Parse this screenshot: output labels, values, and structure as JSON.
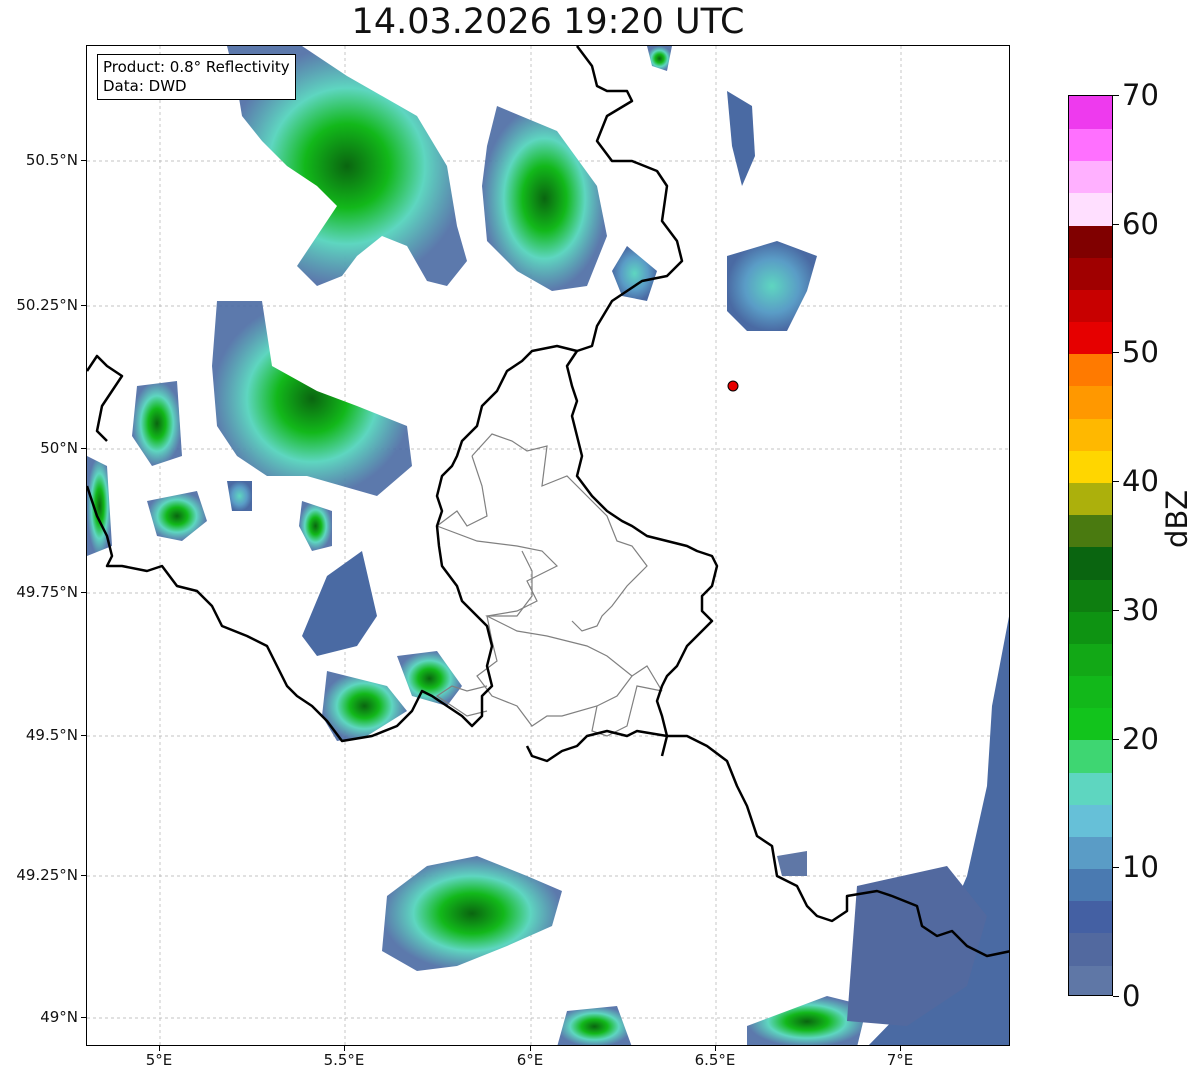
{
  "title": "14.03.2026 19:20 UTC",
  "info_box": {
    "product": "Product: 0.8° Reflectivity",
    "data": "Data: DWD"
  },
  "axes": {
    "lon_ticks": [
      "5°E",
      "5.5°E",
      "6°E",
      "6.5°E",
      "7°E"
    ],
    "lat_ticks": [
      "50.5°N",
      "50.25°N",
      "50°N",
      "49.75°N",
      "49.5°N",
      "49.25°N",
      "49°N"
    ]
  },
  "colorbar": {
    "unit": "dBZ",
    "range": [
      0,
      70
    ],
    "tick_labels": [
      "0",
      "10",
      "20",
      "30",
      "40",
      "50",
      "60",
      "70"
    ],
    "colors": [
      "#5f77a6",
      "#52699f",
      "#4460a3",
      "#4a7ab1",
      "#5a9cc6",
      "#66c0d8",
      "#5ed6c0",
      "#3ed672",
      "#12c41c",
      "#12b81a",
      "#12a816",
      "#0e9312",
      "#0e7e10",
      "#0a6510",
      "#4a7a10",
      "#acb00c",
      "#ffd600",
      "#ffb800",
      "#ff9800",
      "#ff7a00",
      "#e60000",
      "#c80000",
      "#a00000",
      "#800000",
      "#ffdfff",
      "#ffb0ff",
      "#ff70ff",
      "#ee3aee"
    ]
  },
  "radar_site": {
    "lon": 6.55,
    "lat": 50.11,
    "color": "#e60000"
  },
  "map_extent": {
    "lon": [
      4.8,
      7.3
    ],
    "lat": [
      48.95,
      50.7
    ]
  }
}
